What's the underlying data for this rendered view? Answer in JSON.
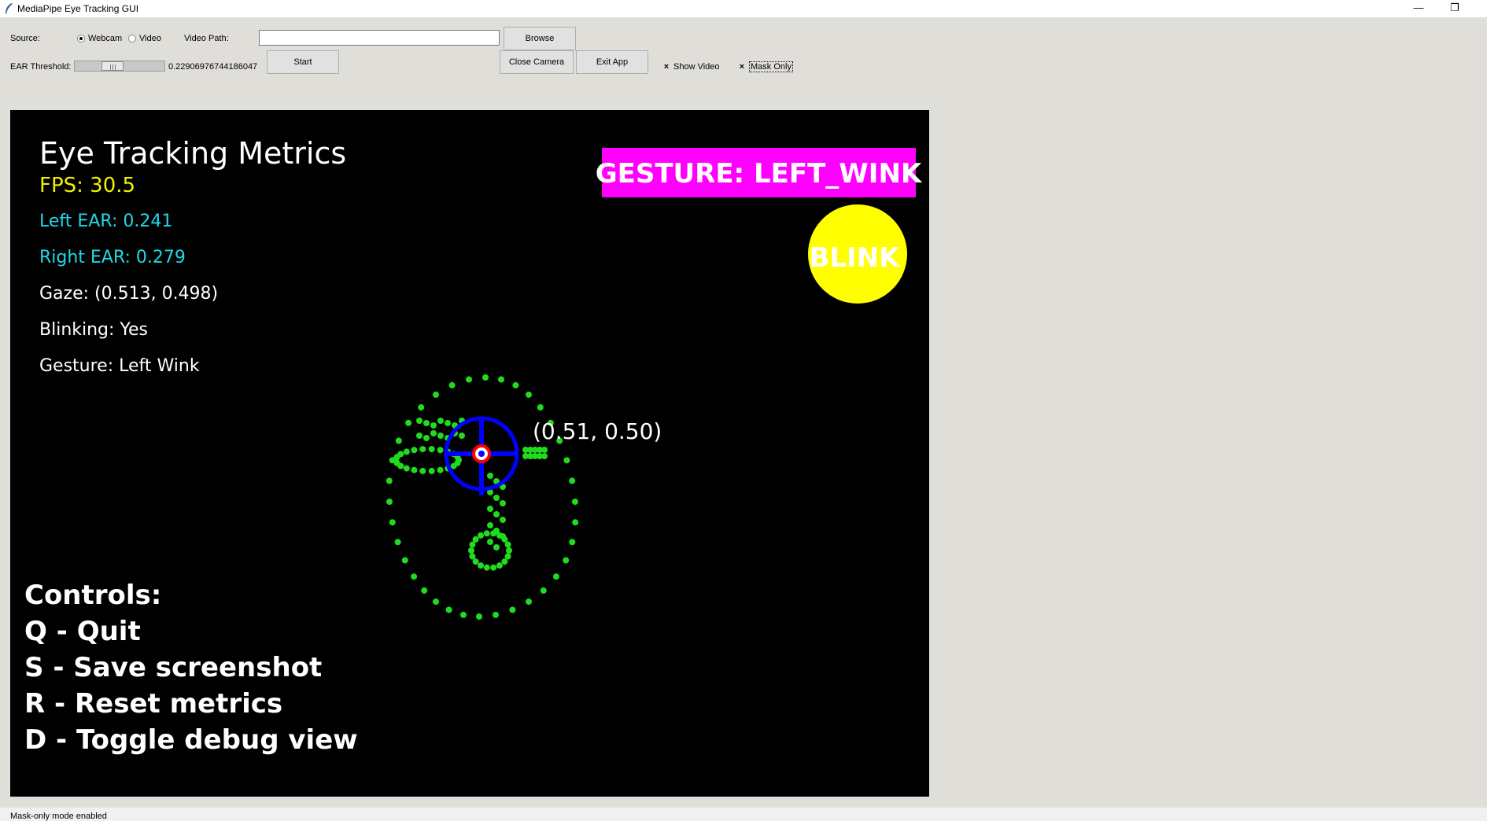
{
  "window": {
    "title": "MediaPipe Eye Tracking GUI",
    "minimize_glyph": "—",
    "restore_glyph": "❐"
  },
  "controls": {
    "source_label": "Source:",
    "source_options": [
      "Webcam",
      "Video"
    ],
    "source_selected": "Webcam",
    "video_path_label": "Video Path:",
    "video_path_value": "",
    "browse_label": "Browse",
    "ear_threshold_label": "EAR Threshold:",
    "ear_threshold_value": "0.22906976744186047",
    "start_label": "Start",
    "close_camera_label": "Close Camera",
    "exit_app_label": "Exit App",
    "show_video_label": "Show Video",
    "show_video_checked": true,
    "mask_only_label": "Mask Only",
    "mask_only_checked": true,
    "check_glyph": "×"
  },
  "overlay": {
    "metrics_title": "Eye Tracking Metrics",
    "fps": "FPS: 30.5",
    "left_ear": "Left EAR: 0.241",
    "right_ear": "Right EAR: 0.279",
    "gaze": "Gaze: (0.513, 0.498)",
    "blinking": "Blinking: Yes",
    "gesture": "Gesture: Left Wink",
    "gesture_banner": "GESTURE: LEFT_WINK",
    "blink_indicator": "BLINK",
    "gaze_coords": "(0.51, 0.50)",
    "controls_title": "Controls:",
    "controls_items": [
      "Q - Quit",
      "S - Save screenshot",
      "R - Reset metrics",
      "D - Toggle debug view"
    ],
    "colors": {
      "fps": "#f0f000",
      "ear": "#20d8e8",
      "text": "#ffffff",
      "banner_bg": "#ff00ff",
      "blink_bg": "#ffff00",
      "landmark": "#1fdc1f",
      "crosshair": "#0000ff",
      "pupil_ring": "#ff0000"
    }
  },
  "status_bar": {
    "text": "Mask-only mode enabled"
  }
}
